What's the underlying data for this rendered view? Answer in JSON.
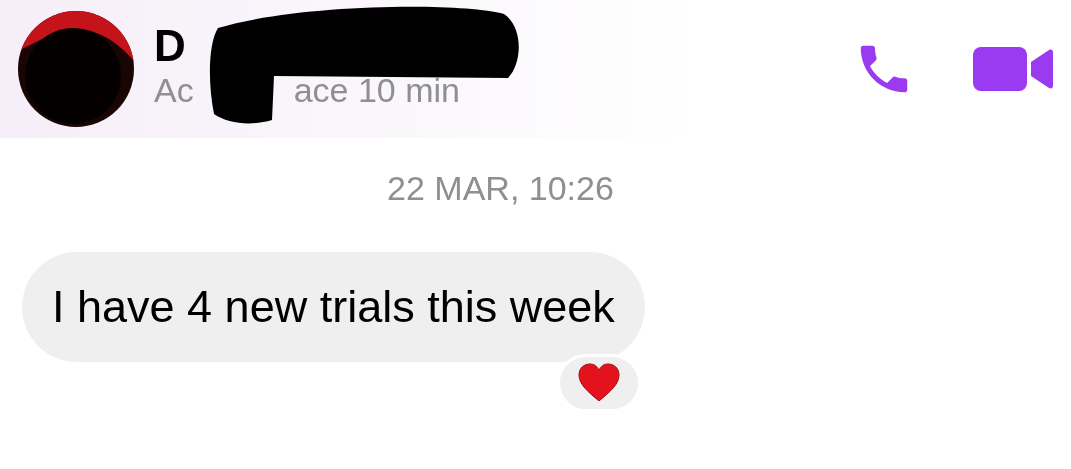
{
  "header": {
    "name": "D",
    "status_parts": [
      "Ac",
      "ace 10 min"
    ]
  },
  "timestamp": "22 MAR, 10:26",
  "messages": [
    {
      "text": "I have 4 new trials this week",
      "reactions": [
        {
          "kind": "heart"
        }
      ]
    }
  ]
}
